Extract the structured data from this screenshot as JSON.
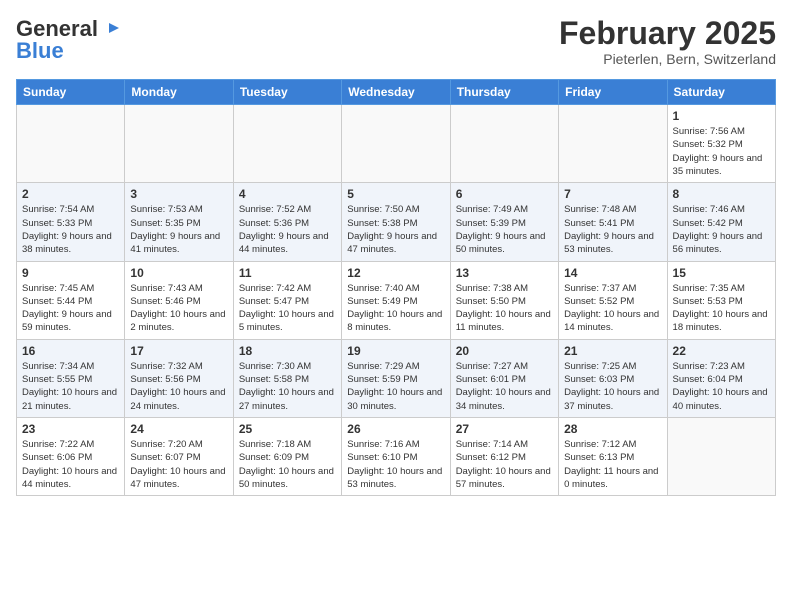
{
  "header": {
    "logo_general": "General",
    "logo_blue": "Blue",
    "month_title": "February 2025",
    "location": "Pieterlen, Bern, Switzerland"
  },
  "weekdays": [
    "Sunday",
    "Monday",
    "Tuesday",
    "Wednesday",
    "Thursday",
    "Friday",
    "Saturday"
  ],
  "weeks": [
    [
      {
        "day": "",
        "info": ""
      },
      {
        "day": "",
        "info": ""
      },
      {
        "day": "",
        "info": ""
      },
      {
        "day": "",
        "info": ""
      },
      {
        "day": "",
        "info": ""
      },
      {
        "day": "",
        "info": ""
      },
      {
        "day": "1",
        "info": "Sunrise: 7:56 AM\nSunset: 5:32 PM\nDaylight: 9 hours and 35 minutes."
      }
    ],
    [
      {
        "day": "2",
        "info": "Sunrise: 7:54 AM\nSunset: 5:33 PM\nDaylight: 9 hours and 38 minutes."
      },
      {
        "day": "3",
        "info": "Sunrise: 7:53 AM\nSunset: 5:35 PM\nDaylight: 9 hours and 41 minutes."
      },
      {
        "day": "4",
        "info": "Sunrise: 7:52 AM\nSunset: 5:36 PM\nDaylight: 9 hours and 44 minutes."
      },
      {
        "day": "5",
        "info": "Sunrise: 7:50 AM\nSunset: 5:38 PM\nDaylight: 9 hours and 47 minutes."
      },
      {
        "day": "6",
        "info": "Sunrise: 7:49 AM\nSunset: 5:39 PM\nDaylight: 9 hours and 50 minutes."
      },
      {
        "day": "7",
        "info": "Sunrise: 7:48 AM\nSunset: 5:41 PM\nDaylight: 9 hours and 53 minutes."
      },
      {
        "day": "8",
        "info": "Sunrise: 7:46 AM\nSunset: 5:42 PM\nDaylight: 9 hours and 56 minutes."
      }
    ],
    [
      {
        "day": "9",
        "info": "Sunrise: 7:45 AM\nSunset: 5:44 PM\nDaylight: 9 hours and 59 minutes."
      },
      {
        "day": "10",
        "info": "Sunrise: 7:43 AM\nSunset: 5:46 PM\nDaylight: 10 hours and 2 minutes."
      },
      {
        "day": "11",
        "info": "Sunrise: 7:42 AM\nSunset: 5:47 PM\nDaylight: 10 hours and 5 minutes."
      },
      {
        "day": "12",
        "info": "Sunrise: 7:40 AM\nSunset: 5:49 PM\nDaylight: 10 hours and 8 minutes."
      },
      {
        "day": "13",
        "info": "Sunrise: 7:38 AM\nSunset: 5:50 PM\nDaylight: 10 hours and 11 minutes."
      },
      {
        "day": "14",
        "info": "Sunrise: 7:37 AM\nSunset: 5:52 PM\nDaylight: 10 hours and 14 minutes."
      },
      {
        "day": "15",
        "info": "Sunrise: 7:35 AM\nSunset: 5:53 PM\nDaylight: 10 hours and 18 minutes."
      }
    ],
    [
      {
        "day": "16",
        "info": "Sunrise: 7:34 AM\nSunset: 5:55 PM\nDaylight: 10 hours and 21 minutes."
      },
      {
        "day": "17",
        "info": "Sunrise: 7:32 AM\nSunset: 5:56 PM\nDaylight: 10 hours and 24 minutes."
      },
      {
        "day": "18",
        "info": "Sunrise: 7:30 AM\nSunset: 5:58 PM\nDaylight: 10 hours and 27 minutes."
      },
      {
        "day": "19",
        "info": "Sunrise: 7:29 AM\nSunset: 5:59 PM\nDaylight: 10 hours and 30 minutes."
      },
      {
        "day": "20",
        "info": "Sunrise: 7:27 AM\nSunset: 6:01 PM\nDaylight: 10 hours and 34 minutes."
      },
      {
        "day": "21",
        "info": "Sunrise: 7:25 AM\nSunset: 6:03 PM\nDaylight: 10 hours and 37 minutes."
      },
      {
        "day": "22",
        "info": "Sunrise: 7:23 AM\nSunset: 6:04 PM\nDaylight: 10 hours and 40 minutes."
      }
    ],
    [
      {
        "day": "23",
        "info": "Sunrise: 7:22 AM\nSunset: 6:06 PM\nDaylight: 10 hours and 44 minutes."
      },
      {
        "day": "24",
        "info": "Sunrise: 7:20 AM\nSunset: 6:07 PM\nDaylight: 10 hours and 47 minutes."
      },
      {
        "day": "25",
        "info": "Sunrise: 7:18 AM\nSunset: 6:09 PM\nDaylight: 10 hours and 50 minutes."
      },
      {
        "day": "26",
        "info": "Sunrise: 7:16 AM\nSunset: 6:10 PM\nDaylight: 10 hours and 53 minutes."
      },
      {
        "day": "27",
        "info": "Sunrise: 7:14 AM\nSunset: 6:12 PM\nDaylight: 10 hours and 57 minutes."
      },
      {
        "day": "28",
        "info": "Sunrise: 7:12 AM\nSunset: 6:13 PM\nDaylight: 11 hours and 0 minutes."
      },
      {
        "day": "",
        "info": ""
      }
    ]
  ]
}
